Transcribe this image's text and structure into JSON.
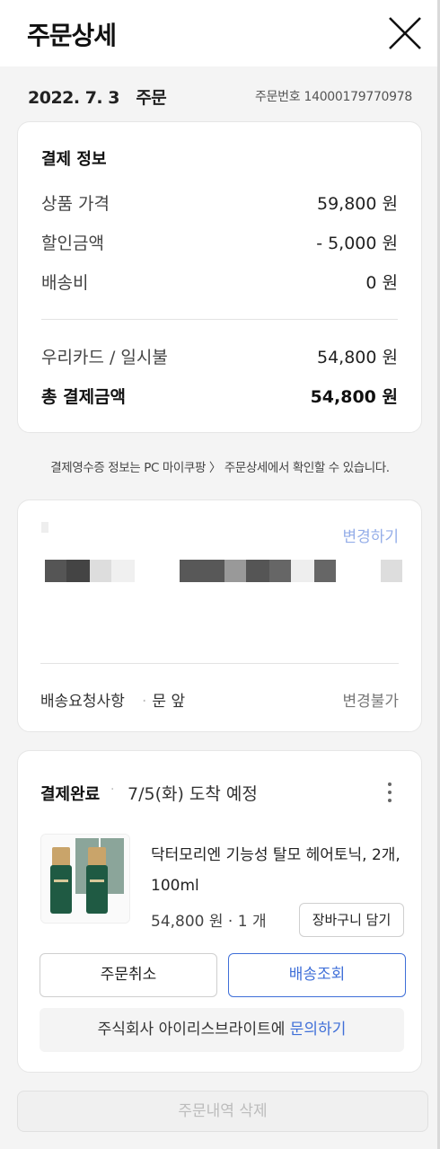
{
  "header": {
    "title": "주문상세"
  },
  "order": {
    "date_label": "2022. 7. 3   주문",
    "order_number": "주문번호 14000179770978"
  },
  "payment": {
    "title": "결제 정보",
    "rows": [
      {
        "label": "상품 가격",
        "value": "59,800 원"
      },
      {
        "label": "할인금액",
        "value": "- 5,000 원"
      },
      {
        "label": "배송비",
        "value": "0 원"
      },
      {
        "label": "우리카드 / 일시불",
        "value": "54,800 원"
      },
      {
        "label": "총 결제금액",
        "value": "54,800 원"
      }
    ]
  },
  "receipt_note": "결제영수증 정보는 PC 마이쿠팡 〉 주문상세에서 확인할 수 있습니다.",
  "address": {
    "change_label": "변경하기",
    "request_label": "배송요청사항",
    "request_value": "문 앞",
    "request_status": "변경불가"
  },
  "shipment": {
    "status": "결제완료",
    "eta": "7/5(화) 도착 예정",
    "product_name": "닥터모리엔 기능성 탈모 헤어토닉, 2개, 100ml",
    "price_qty": "54,800 원 · 1 개",
    "cart_label": "장바구니 담기",
    "cancel_label": "주문취소",
    "track_label": "배송조회",
    "inquire_text": "주식회사 아이리스브라이트에 ",
    "inquire_link": "문의하기"
  },
  "delete_label": "주문내역 삭제",
  "colors": {
    "accent": "#3f6fd8",
    "background": "#f4f4f4",
    "card": "#ffffff"
  },
  "icons": {
    "close": "close-icon",
    "more": "more-vertical-icon"
  }
}
